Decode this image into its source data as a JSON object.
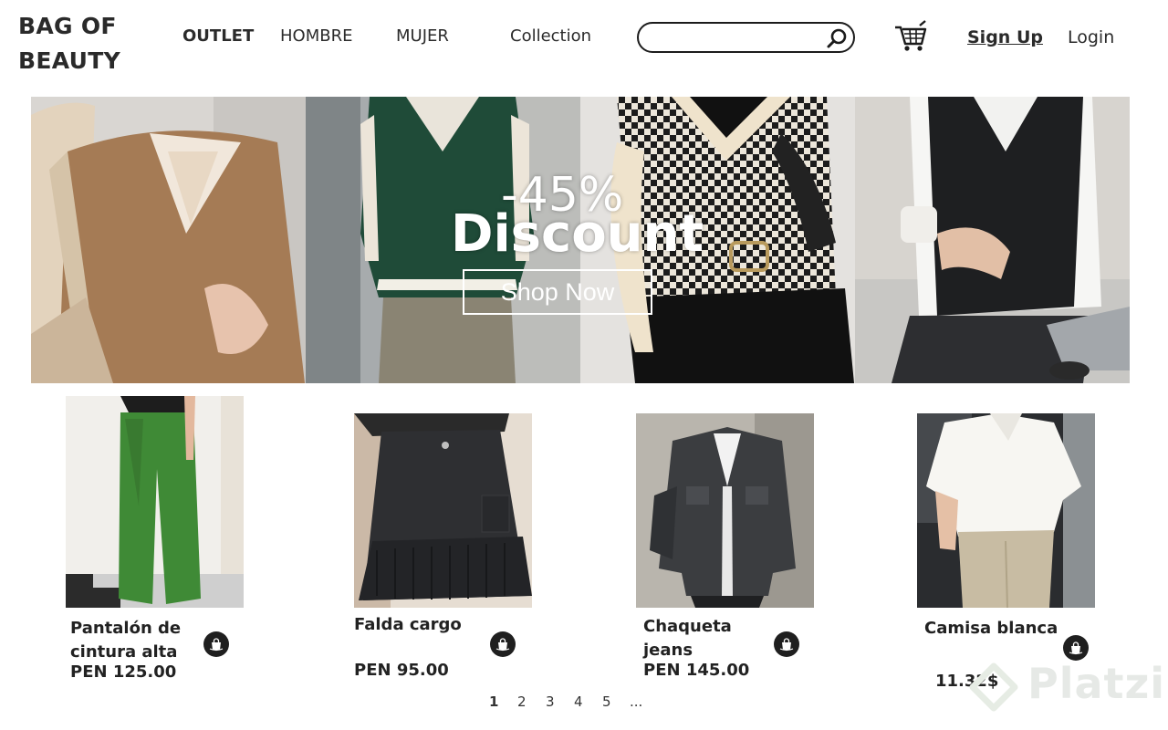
{
  "brand": {
    "line1": "BAG OF",
    "line2": "BEAUTY"
  },
  "nav": {
    "outlet": "OUTLET",
    "hombre": "HOMBRE",
    "mujer": "MUJER",
    "collection": "Collection"
  },
  "search": {
    "value": "",
    "placeholder": ""
  },
  "account": {
    "signup": "Sign Up",
    "login": "Login"
  },
  "icons": {
    "search": "search-icon",
    "cart": "shopping-cart-icon",
    "bag": "shopping-bag-icon"
  },
  "hero": {
    "discount_percent": "-45%",
    "discount_word": "Discount",
    "cta": "Shop Now"
  },
  "products": [
    {
      "name_line1": "Pantalón de",
      "name_line2": "cintura alta",
      "price": "PEN 125.00"
    },
    {
      "name_line1": "Falda cargo",
      "name_line2": "",
      "price": "PEN 95.00"
    },
    {
      "name_line1": "Chaqueta",
      "name_line2": "jeans",
      "price": "PEN 145.00"
    },
    {
      "name_line1": "Camisa blanca",
      "name_line2": "",
      "price": "11.32$"
    }
  ],
  "pagination": {
    "pages": [
      "1",
      "2",
      "3",
      "4",
      "5",
      "..."
    ],
    "current": "1"
  },
  "watermark": "Platzi",
  "colors": {
    "text": "#1e1e1e",
    "button_dark": "#1f1f1f",
    "background": "#ffffff"
  }
}
